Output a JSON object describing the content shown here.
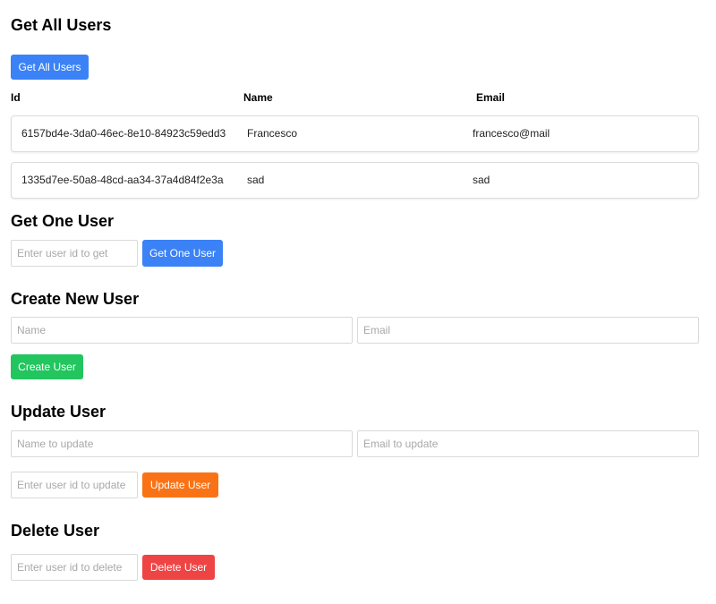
{
  "get_all": {
    "heading": "Get All Users",
    "button_label": "Get All Users",
    "columns": {
      "id": "Id",
      "name": "Name",
      "email": "Email"
    },
    "users": [
      {
        "id": "6157bd4e-3da0-46ec-8e10-84923c59edd3",
        "name": "Francesco",
        "email": "francesco@mail"
      },
      {
        "id": "1335d7ee-50a8-48cd-aa34-37a4d84f2e3a",
        "name": "sad",
        "email": "sad"
      }
    ]
  },
  "get_one": {
    "heading": "Get One User",
    "id_placeholder": "Enter user id to get",
    "button_label": "Get One User"
  },
  "create": {
    "heading": "Create New User",
    "name_placeholder": "Name",
    "email_placeholder": "Email",
    "button_label": "Create User"
  },
  "update": {
    "heading": "Update User",
    "name_placeholder": "Name to update",
    "email_placeholder": "Email to update",
    "id_placeholder": "Enter user id to update",
    "button_label": "Update User"
  },
  "delete": {
    "heading": "Delete User",
    "id_placeholder": "Enter user id to delete",
    "button_label": "Delete User"
  },
  "colors": {
    "get_button": "#3b82f6",
    "create_button": "#22c55e",
    "update_button": "#f97316",
    "delete_button": "#ef4444"
  }
}
